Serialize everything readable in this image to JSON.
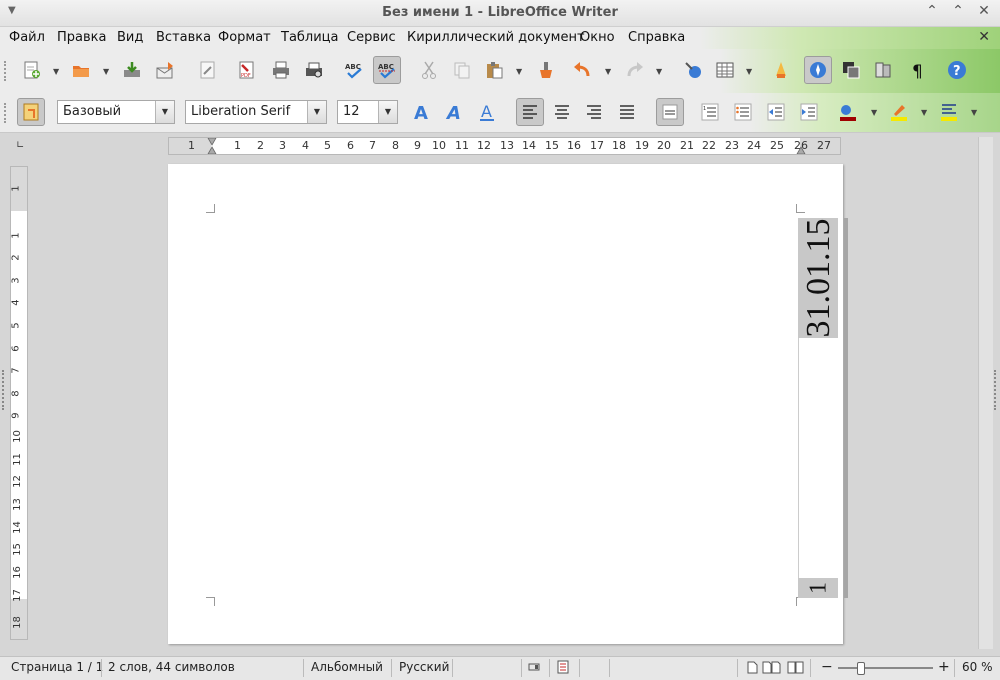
{
  "window": {
    "title": "Без имени 1 - LibreOffice Writer"
  },
  "menu": [
    "Файл",
    "Правка",
    "Вид",
    "Вставка",
    "Формат",
    "Таблица",
    "Сервис",
    "Кириллический документ",
    "Окно",
    "Справка"
  ],
  "formatting": {
    "style": "Базовый",
    "font": "Liberation Serif",
    "size": "12"
  },
  "ruler": {
    "h_numbers": [
      "1",
      "1",
      "2",
      "3",
      "4",
      "5",
      "6",
      "7",
      "8",
      "9",
      "10",
      "11",
      "12",
      "13",
      "14",
      "15",
      "16",
      "17",
      "18",
      "19",
      "20",
      "21",
      "22",
      "23",
      "24",
      "25",
      "26",
      "27"
    ],
    "v_numbers": [
      "1",
      "1",
      "2",
      "3",
      "4",
      "5",
      "6",
      "7",
      "8",
      "9",
      "10",
      "11",
      "12",
      "13",
      "14",
      "15",
      "16",
      "17",
      "18"
    ]
  },
  "document": {
    "date_field": "31.01.15",
    "page_number_field": "1"
  },
  "status": {
    "page": "Страница 1 / 1",
    "words": "2 слов, 44 символов",
    "orientation": "Альбомный",
    "language": "Русский",
    "zoom": "60 %"
  },
  "colors": {
    "accent_green": "#8cc867",
    "page_bg": "#ffffff",
    "workspace": "#d6d6d6"
  }
}
